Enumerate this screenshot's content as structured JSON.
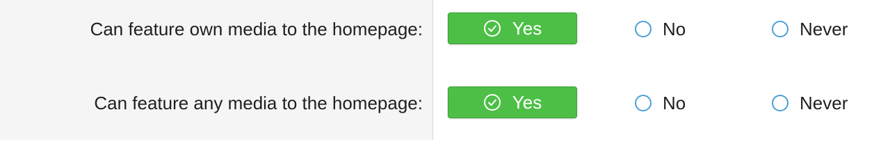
{
  "colors": {
    "yes_button_bg": "#4dbf46",
    "radio_border": "#4a9fd8",
    "label_panel_bg": "#f5f5f5"
  },
  "permissions": [
    {
      "label": "Can feature own media to the homepage:",
      "selected": "Yes",
      "options": {
        "yes": "Yes",
        "no": "No",
        "never": "Never"
      }
    },
    {
      "label": "Can feature any media to the homepage:",
      "selected": "Yes",
      "options": {
        "yes": "Yes",
        "no": "No",
        "never": "Never"
      }
    }
  ],
  "icons": {
    "yes": "check-circle-icon",
    "unselected": "radio-circle-icon"
  }
}
